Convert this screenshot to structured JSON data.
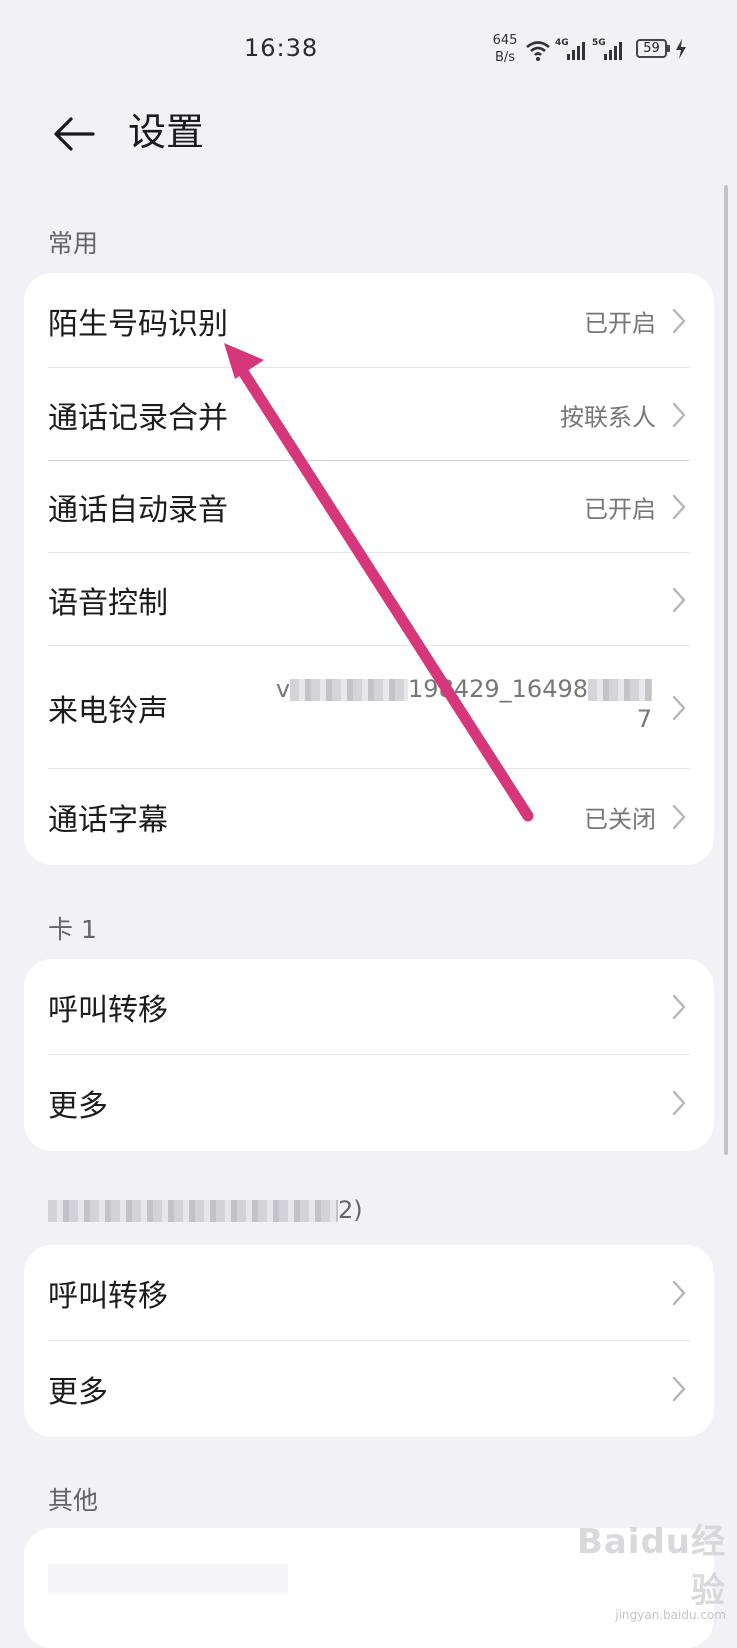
{
  "status_bar": {
    "time": "16:38",
    "net_speed_value": "645",
    "net_speed_unit": "B/s",
    "battery": "59",
    "network_1": "4G",
    "network_2": "5G"
  },
  "header": {
    "title": "设置"
  },
  "sections": {
    "common": {
      "title": "常用",
      "items": [
        {
          "label": "陌生号码识别",
          "value": "已开启"
        },
        {
          "label": "通话记录合并",
          "value": "按联系人"
        },
        {
          "label": "通话自动录音",
          "value": "已开启"
        },
        {
          "label": "语音控制",
          "value": ""
        },
        {
          "label": "来电铃声",
          "value_visible_part_1": "v",
          "value_visible_part_2": "198429_16498",
          "value_visible_part_3": "7"
        },
        {
          "label": "通话字幕",
          "value": "已关闭"
        }
      ]
    },
    "sim1": {
      "title": "卡 1",
      "items": [
        {
          "label": "呼叫转移"
        },
        {
          "label": "更多"
        }
      ]
    },
    "sim2": {
      "title_visible_part": "2)",
      "items": [
        {
          "label": "呼叫转移"
        },
        {
          "label": "更多"
        }
      ]
    },
    "other": {
      "title": "其他"
    }
  },
  "watermark": {
    "brand": "Baidu经验",
    "sub": "jingyan.baidu.com"
  },
  "colors": {
    "background": "#f1f1f6",
    "card": "#ffffff",
    "arrow": "#d6367a"
  }
}
